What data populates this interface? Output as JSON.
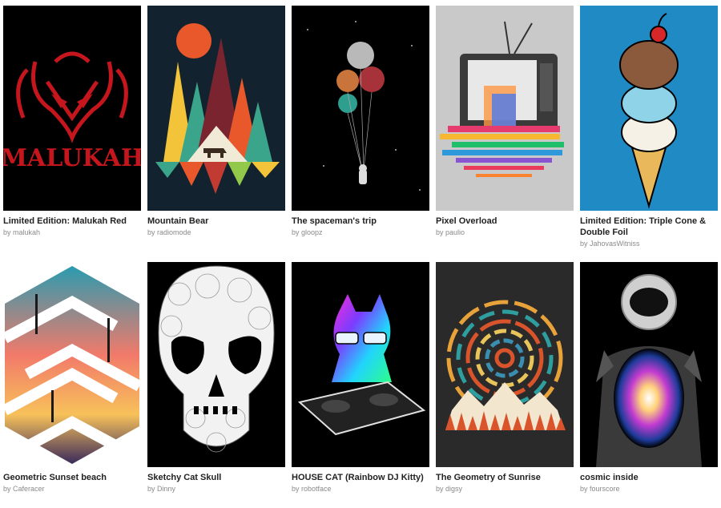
{
  "by_prefix": "by",
  "colors": {
    "title_text": "#222222",
    "author_text": "#8a8a8a",
    "malukah_bg": "#000000",
    "malukah_red": "#c4161c",
    "mountain_bg": "#12222e",
    "spaceman_bg": "#000000",
    "pixel_bg": "#c9c9c9",
    "icecream_bg": "#1f8ac4",
    "sketchy_bg": "#000000",
    "housecat_bg": "#000000",
    "sunrise_bg": "#2a2a2a",
    "cosmic_bg": "#000000"
  },
  "products": [
    {
      "title": "Limited Edition: Malukah Red",
      "author": "malukah",
      "artwork_text": "MALUKAH"
    },
    {
      "title": "Mountain Bear",
      "author": "radiomode"
    },
    {
      "title": "The spaceman's trip",
      "author": "gloopz"
    },
    {
      "title": "Pixel Overload",
      "author": "paulio"
    },
    {
      "title": "Limited Edition: Triple Cone & Double Foil",
      "author": "JahovasWitniss"
    },
    {
      "title": "Geometric Sunset beach",
      "author": "Caferacer"
    },
    {
      "title": "Sketchy Cat Skull",
      "author": "Dinny"
    },
    {
      "title": "HOUSE CAT (Rainbow DJ Kitty)",
      "author": "robotface"
    },
    {
      "title": "The Geometry of Sunrise",
      "author": "digsy"
    },
    {
      "title": "cosmic inside",
      "author": "fourscore"
    }
  ]
}
